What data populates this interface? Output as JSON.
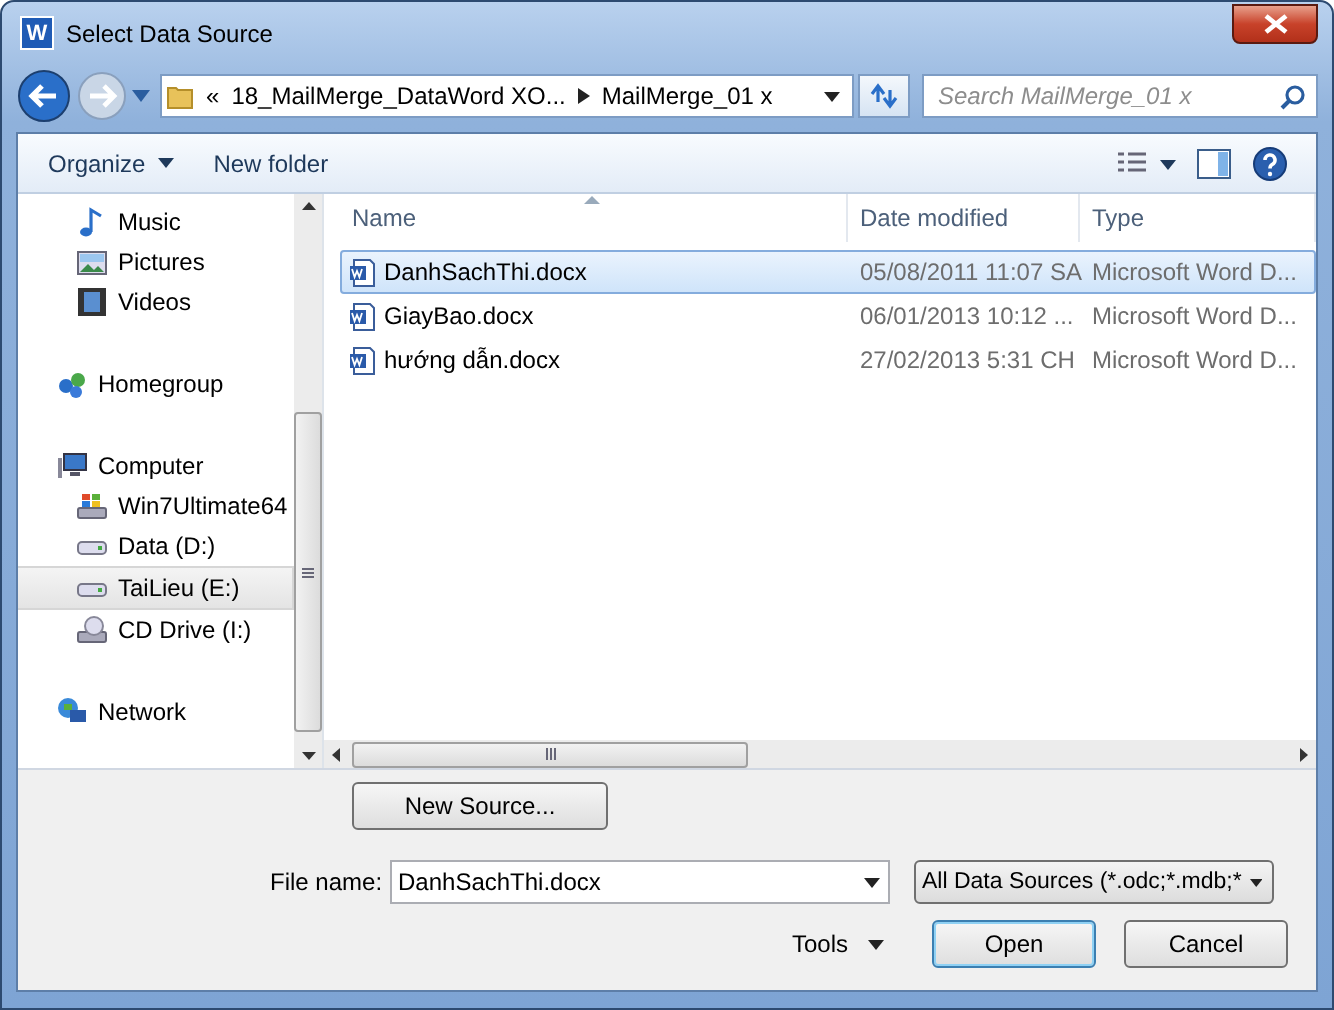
{
  "window": {
    "title": "Select Data Source",
    "icon_letter": "W"
  },
  "address": {
    "segments": [
      "«",
      "18_MailMerge_DataWord XO...",
      "MailMerge_01 x"
    ]
  },
  "search": {
    "placeholder": "Search MailMerge_01 x"
  },
  "toolbar": {
    "organize": "Organize",
    "new_folder": "New folder"
  },
  "sidebar": {
    "items": [
      {
        "children": [
          {
            "label": "Music",
            "kind": "music",
            "selected": false
          },
          {
            "label": "Pictures",
            "kind": "pictures",
            "selected": false
          },
          {
            "label": "Videos",
            "kind": "videos",
            "selected": false
          }
        ]
      },
      {
        "label": "Homegroup",
        "kind": "homegroup",
        "selected": false
      },
      {
        "label": "Computer",
        "kind": "computer",
        "selected": false,
        "children": [
          {
            "label": "Win7Ultimate64",
            "kind": "system",
            "selected": false
          },
          {
            "label": "Data (D:)",
            "kind": "drive",
            "selected": false
          },
          {
            "label": "TaiLieu (E:)",
            "kind": "drive",
            "selected": true
          },
          {
            "label": "CD Drive (I:)",
            "kind": "cd",
            "selected": false
          }
        ]
      },
      {
        "label": "Network",
        "kind": "network",
        "selected": false
      }
    ]
  },
  "table": {
    "columns": [
      "Name",
      "Date modified",
      "Type"
    ],
    "rows": [
      {
        "name": "DanhSachThi.docx",
        "date": "05/08/2011 11:07 SA",
        "type": "Microsoft Word D...",
        "selected": true
      },
      {
        "name": "GiayBao.docx",
        "date": "06/01/2013 10:12 ...",
        "type": "Microsoft Word D...",
        "selected": false
      },
      {
        "name": "hướng dẫn.docx",
        "date": "27/02/2013 5:31 CH",
        "type": "Microsoft Word D...",
        "selected": false
      }
    ]
  },
  "new_source": "New Source...",
  "file_name": {
    "label": "File name:",
    "value": "DanhSachThi.docx"
  },
  "filter": "All Data Sources (*.odc;*.mdb;*",
  "tools": "Tools",
  "buttons": [
    "Open",
    "Cancel"
  ]
}
